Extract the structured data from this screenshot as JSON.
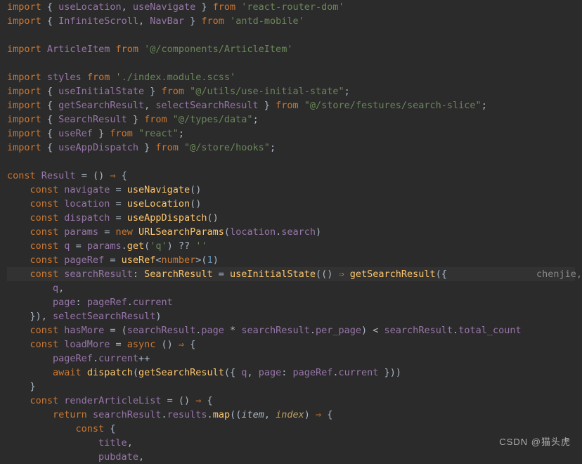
{
  "code": {
    "watermark": "CSDN @猫头虎",
    "chenjie": "chenjie,",
    "lines": [
      [
        {
          "t": "import",
          "c": "kw"
        },
        {
          "t": " { ",
          "c": "pn"
        },
        {
          "t": "useLocation",
          "c": "id"
        },
        {
          "t": ", ",
          "c": "pn"
        },
        {
          "t": "useNavigate",
          "c": "id"
        },
        {
          "t": " } ",
          "c": "pn"
        },
        {
          "t": "from",
          "c": "kw"
        },
        {
          "t": " ",
          "c": "pn"
        },
        {
          "t": "'react-router-dom'",
          "c": "str"
        }
      ],
      [
        {
          "t": "import",
          "c": "kw"
        },
        {
          "t": " { ",
          "c": "pn"
        },
        {
          "t": "InfiniteScroll",
          "c": "id"
        },
        {
          "t": ", ",
          "c": "pn"
        },
        {
          "t": "NavBar",
          "c": "id"
        },
        {
          "t": " } ",
          "c": "pn"
        },
        {
          "t": "from",
          "c": "kw"
        },
        {
          "t": " ",
          "c": "pn"
        },
        {
          "t": "'antd-mobile'",
          "c": "str"
        }
      ],
      [],
      [
        {
          "t": "import",
          "c": "kw"
        },
        {
          "t": " ",
          "c": "pn"
        },
        {
          "t": "ArticleItem",
          "c": "id"
        },
        {
          "t": " ",
          "c": "pn"
        },
        {
          "t": "from",
          "c": "kw"
        },
        {
          "t": " ",
          "c": "pn"
        },
        {
          "t": "'@/components/ArticleItem'",
          "c": "str"
        }
      ],
      [],
      [
        {
          "t": "import",
          "c": "kw"
        },
        {
          "t": " ",
          "c": "pn"
        },
        {
          "t": "styles",
          "c": "id"
        },
        {
          "t": " ",
          "c": "pn"
        },
        {
          "t": "from",
          "c": "kw"
        },
        {
          "t": " ",
          "c": "pn"
        },
        {
          "t": "'./index.module.scss'",
          "c": "str"
        }
      ],
      [
        {
          "t": "import",
          "c": "kw"
        },
        {
          "t": " { ",
          "c": "pn"
        },
        {
          "t": "useInitialState",
          "c": "id"
        },
        {
          "t": " } ",
          "c": "pn"
        },
        {
          "t": "from",
          "c": "kw"
        },
        {
          "t": " ",
          "c": "pn"
        },
        {
          "t": "\"@/utils/use-initial-state\"",
          "c": "str"
        },
        {
          "t": ";",
          "c": "pn"
        }
      ],
      [
        {
          "t": "import",
          "c": "kw"
        },
        {
          "t": " { ",
          "c": "pn"
        },
        {
          "t": "getSearchResult",
          "c": "id"
        },
        {
          "t": ", ",
          "c": "pn"
        },
        {
          "t": "selectSearchResult",
          "c": "id"
        },
        {
          "t": " } ",
          "c": "pn"
        },
        {
          "t": "from",
          "c": "kw"
        },
        {
          "t": " ",
          "c": "pn"
        },
        {
          "t": "\"@/store/festures/search-slice\"",
          "c": "str"
        },
        {
          "t": ";",
          "c": "pn"
        }
      ],
      [
        {
          "t": "import",
          "c": "kw"
        },
        {
          "t": " { ",
          "c": "pn"
        },
        {
          "t": "SearchResult",
          "c": "id"
        },
        {
          "t": " } ",
          "c": "pn"
        },
        {
          "t": "from",
          "c": "kw"
        },
        {
          "t": " ",
          "c": "pn"
        },
        {
          "t": "\"@/types/data\"",
          "c": "str"
        },
        {
          "t": ";",
          "c": "pn"
        }
      ],
      [
        {
          "t": "import",
          "c": "kw"
        },
        {
          "t": " { ",
          "c": "pn"
        },
        {
          "t": "useRef",
          "c": "id"
        },
        {
          "t": " } ",
          "c": "pn"
        },
        {
          "t": "from",
          "c": "kw"
        },
        {
          "t": " ",
          "c": "pn"
        },
        {
          "t": "\"react\"",
          "c": "str"
        },
        {
          "t": ";",
          "c": "pn"
        }
      ],
      [
        {
          "t": "import",
          "c": "kw"
        },
        {
          "t": " { ",
          "c": "pn"
        },
        {
          "t": "useAppDispatch",
          "c": "id"
        },
        {
          "t": " } ",
          "c": "pn"
        },
        {
          "t": "from",
          "c": "kw"
        },
        {
          "t": " ",
          "c": "pn"
        },
        {
          "t": "\"@/store/hooks\"",
          "c": "str"
        },
        {
          "t": ";",
          "c": "pn"
        }
      ],
      [],
      [
        {
          "t": "const",
          "c": "kw"
        },
        {
          "t": " ",
          "c": "pn"
        },
        {
          "t": "Result",
          "c": "id"
        },
        {
          "t": " = () ",
          "c": "pn"
        },
        {
          "t": "⇒",
          "c": "kw"
        },
        {
          "t": " {",
          "c": "pn"
        }
      ],
      [
        {
          "t": "    ",
          "c": "pn"
        },
        {
          "t": "const",
          "c": "kw"
        },
        {
          "t": " ",
          "c": "pn"
        },
        {
          "t": "navigate",
          "c": "id"
        },
        {
          "t": " = ",
          "c": "pn"
        },
        {
          "t": "useNavigate",
          "c": "fn"
        },
        {
          "t": "()",
          "c": "pn"
        }
      ],
      [
        {
          "t": "    ",
          "c": "pn"
        },
        {
          "t": "const",
          "c": "kw"
        },
        {
          "t": " ",
          "c": "pn"
        },
        {
          "t": "location",
          "c": "id"
        },
        {
          "t": " = ",
          "c": "pn"
        },
        {
          "t": "useLocation",
          "c": "fn"
        },
        {
          "t": "()",
          "c": "pn"
        }
      ],
      [
        {
          "t": "    ",
          "c": "pn"
        },
        {
          "t": "const",
          "c": "kw"
        },
        {
          "t": " ",
          "c": "pn"
        },
        {
          "t": "dispatch",
          "c": "id"
        },
        {
          "t": " = ",
          "c": "pn"
        },
        {
          "t": "useAppDispatch",
          "c": "fn"
        },
        {
          "t": "()",
          "c": "pn"
        }
      ],
      [
        {
          "t": "    ",
          "c": "pn"
        },
        {
          "t": "const",
          "c": "kw"
        },
        {
          "t": " ",
          "c": "pn"
        },
        {
          "t": "params",
          "c": "id"
        },
        {
          "t": " = ",
          "c": "pn"
        },
        {
          "t": "new",
          "c": "new"
        },
        {
          "t": " ",
          "c": "pn"
        },
        {
          "t": "URLSearchParams",
          "c": "fn"
        },
        {
          "t": "(",
          "c": "pn"
        },
        {
          "t": "location",
          "c": "id"
        },
        {
          "t": ".",
          "c": "pn"
        },
        {
          "t": "search",
          "c": "id"
        },
        {
          "t": ")",
          "c": "pn"
        }
      ],
      [
        {
          "t": "    ",
          "c": "pn"
        },
        {
          "t": "const",
          "c": "kw"
        },
        {
          "t": " ",
          "c": "pn"
        },
        {
          "t": "q",
          "c": "id"
        },
        {
          "t": " = ",
          "c": "pn"
        },
        {
          "t": "params",
          "c": "id"
        },
        {
          "t": ".",
          "c": "pn"
        },
        {
          "t": "get",
          "c": "fn"
        },
        {
          "t": "(",
          "c": "pn"
        },
        {
          "t": "'q'",
          "c": "str"
        },
        {
          "t": ") ?? ",
          "c": "pn"
        },
        {
          "t": "''",
          "c": "str"
        }
      ],
      [
        {
          "t": "    ",
          "c": "pn"
        },
        {
          "t": "const",
          "c": "kw"
        },
        {
          "t": " ",
          "c": "pn"
        },
        {
          "t": "pageRef",
          "c": "id"
        },
        {
          "t": " = ",
          "c": "pn"
        },
        {
          "t": "useRef",
          "c": "fn"
        },
        {
          "t": "<",
          "c": "pn"
        },
        {
          "t": "number",
          "c": "kw"
        },
        {
          "t": ">(",
          "c": "pn"
        },
        {
          "t": "1",
          "c": "num"
        },
        {
          "t": ")",
          "c": "pn"
        }
      ],
      [
        {
          "t": "    ",
          "c": "pn"
        },
        {
          "t": "const",
          "c": "kw"
        },
        {
          "t": " ",
          "c": "pn"
        },
        {
          "t": "searchResult",
          "c": "id"
        },
        {
          "t": ": ",
          "c": "pn"
        },
        {
          "t": "SearchResult",
          "c": "fn"
        },
        {
          "t": " = ",
          "c": "pn"
        },
        {
          "t": "useInitialState",
          "c": "fn"
        },
        {
          "t": "(() ",
          "c": "pn"
        },
        {
          "t": "⇒",
          "c": "kw"
        },
        {
          "t": " ",
          "c": "pn"
        },
        {
          "t": "getSearchResult",
          "c": "fn"
        },
        {
          "t": "({",
          "c": "pn"
        }
      ],
      [
        {
          "t": "        ",
          "c": "pn"
        },
        {
          "t": "q",
          "c": "id"
        },
        {
          "t": ",",
          "c": "pn"
        }
      ],
      [
        {
          "t": "        ",
          "c": "pn"
        },
        {
          "t": "page",
          "c": "id"
        },
        {
          "t": ": ",
          "c": "pn"
        },
        {
          "t": "pageRef",
          "c": "id"
        },
        {
          "t": ".",
          "c": "pn"
        },
        {
          "t": "current",
          "c": "id"
        }
      ],
      [
        {
          "t": "    }), ",
          "c": "pn"
        },
        {
          "t": "selectSearchResult",
          "c": "id"
        },
        {
          "t": ")",
          "c": "pn"
        }
      ],
      [
        {
          "t": "    ",
          "c": "pn"
        },
        {
          "t": "const",
          "c": "kw"
        },
        {
          "t": " ",
          "c": "pn"
        },
        {
          "t": "hasMore",
          "c": "id"
        },
        {
          "t": " = (",
          "c": "pn"
        },
        {
          "t": "searchResult",
          "c": "id"
        },
        {
          "t": ".",
          "c": "pn"
        },
        {
          "t": "page",
          "c": "id"
        },
        {
          "t": " * ",
          "c": "pn"
        },
        {
          "t": "searchResult",
          "c": "id"
        },
        {
          "t": ".",
          "c": "pn"
        },
        {
          "t": "per_page",
          "c": "id"
        },
        {
          "t": ") < ",
          "c": "pn"
        },
        {
          "t": "searchResult",
          "c": "id"
        },
        {
          "t": ".",
          "c": "pn"
        },
        {
          "t": "total_count",
          "c": "id"
        }
      ],
      [
        {
          "t": "    ",
          "c": "pn"
        },
        {
          "t": "const",
          "c": "kw"
        },
        {
          "t": " ",
          "c": "pn"
        },
        {
          "t": "loadMore",
          "c": "id"
        },
        {
          "t": " = ",
          "c": "pn"
        },
        {
          "t": "async",
          "c": "kw"
        },
        {
          "t": " () ",
          "c": "pn"
        },
        {
          "t": "⇒",
          "c": "kw"
        },
        {
          "t": " {",
          "c": "pn"
        }
      ],
      [
        {
          "t": "        ",
          "c": "pn"
        },
        {
          "t": "pageRef",
          "c": "id"
        },
        {
          "t": ".",
          "c": "pn"
        },
        {
          "t": "current",
          "c": "id"
        },
        {
          "t": "++",
          "c": "pn"
        }
      ],
      [
        {
          "t": "        ",
          "c": "pn"
        },
        {
          "t": "await",
          "c": "kw"
        },
        {
          "t": " ",
          "c": "pn"
        },
        {
          "t": "dispatch",
          "c": "fn"
        },
        {
          "t": "(",
          "c": "pn"
        },
        {
          "t": "getSearchResult",
          "c": "fn"
        },
        {
          "t": "({ ",
          "c": "pn"
        },
        {
          "t": "q",
          "c": "id"
        },
        {
          "t": ", ",
          "c": "pn"
        },
        {
          "t": "page",
          "c": "id"
        },
        {
          "t": ": ",
          "c": "pn"
        },
        {
          "t": "pageRef",
          "c": "id"
        },
        {
          "t": ".",
          "c": "pn"
        },
        {
          "t": "current",
          "c": "id"
        },
        {
          "t": " }))",
          "c": "pn"
        }
      ],
      [
        {
          "t": "    }",
          "c": "pn"
        }
      ],
      [
        {
          "t": "    ",
          "c": "pn"
        },
        {
          "t": "const",
          "c": "kw"
        },
        {
          "t": " ",
          "c": "pn"
        },
        {
          "t": "renderArticleList",
          "c": "id"
        },
        {
          "t": " = () ",
          "c": "pn"
        },
        {
          "t": "⇒",
          "c": "kw"
        },
        {
          "t": " {",
          "c": "pn"
        }
      ],
      [
        {
          "t": "        ",
          "c": "pn"
        },
        {
          "t": "return",
          "c": "kw"
        },
        {
          "t": " ",
          "c": "pn"
        },
        {
          "t": "searchResult",
          "c": "id"
        },
        {
          "t": ".",
          "c": "pn"
        },
        {
          "t": "results",
          "c": "id"
        },
        {
          "t": ".",
          "c": "pn"
        },
        {
          "t": "map",
          "c": "fn"
        },
        {
          "t": "((",
          "c": "pn"
        },
        {
          "t": "item",
          "c": "param"
        },
        {
          "t": ", ",
          "c": "pn"
        },
        {
          "t": "index",
          "c": "par2"
        },
        {
          "t": ") ",
          "c": "pn"
        },
        {
          "t": "⇒",
          "c": "kw"
        },
        {
          "t": " {",
          "c": "pn"
        }
      ],
      [
        {
          "t": "            ",
          "c": "pn"
        },
        {
          "t": "const",
          "c": "kw"
        },
        {
          "t": " {",
          "c": "pn"
        }
      ],
      [
        {
          "t": "                ",
          "c": "pn"
        },
        {
          "t": "title",
          "c": "id"
        },
        {
          "t": ",",
          "c": "pn"
        }
      ],
      [
        {
          "t": "                ",
          "c": "pn"
        },
        {
          "t": "pubdate",
          "c": "id"
        },
        {
          "t": ",",
          "c": "pn"
        }
      ]
    ],
    "highlight_line": 19
  }
}
